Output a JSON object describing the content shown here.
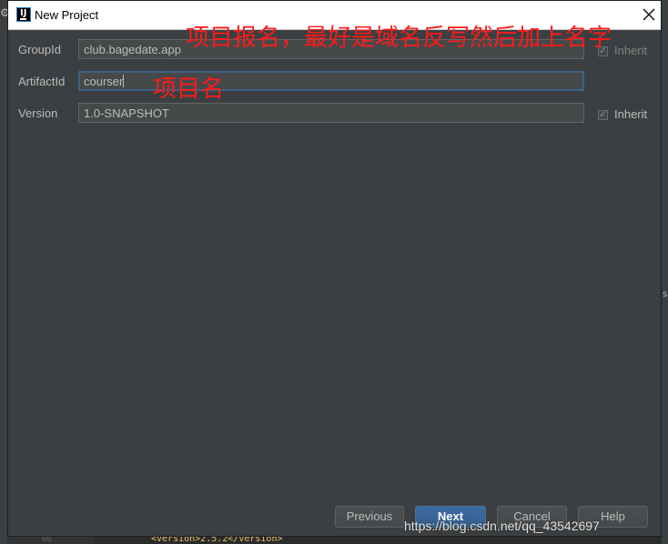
{
  "window": {
    "title": "New Project",
    "app_icon_label": "IJ"
  },
  "form": {
    "group_id": {
      "label": "GroupId",
      "value": "club.bagedate.app",
      "inherit_label": "Inherit"
    },
    "artifact_id": {
      "label": "ArtifactId",
      "value": "courser"
    },
    "version": {
      "label": "Version",
      "value": "1.0-SNAPSHOT",
      "inherit_label": "Inherit"
    }
  },
  "annotations": {
    "group_note": "项目报名，最好是域名反写然后加上名字",
    "artifact_note": "项目名"
  },
  "buttons": {
    "previous": "Previous",
    "next": "Next",
    "cancel": "Cancel",
    "help": "Help"
  },
  "watermark": "https://blog.csdn.net/qq_43542697",
  "background": {
    "line_number": "66",
    "code_snippet": "<version>2.5.2</version>"
  },
  "colors": {
    "dialog_bg": "#3c3f41",
    "field_bg": "#45494a",
    "focus_border": "#3d6185",
    "annotation_red": "#ff1a1a",
    "primary_button": "#365f8f"
  }
}
